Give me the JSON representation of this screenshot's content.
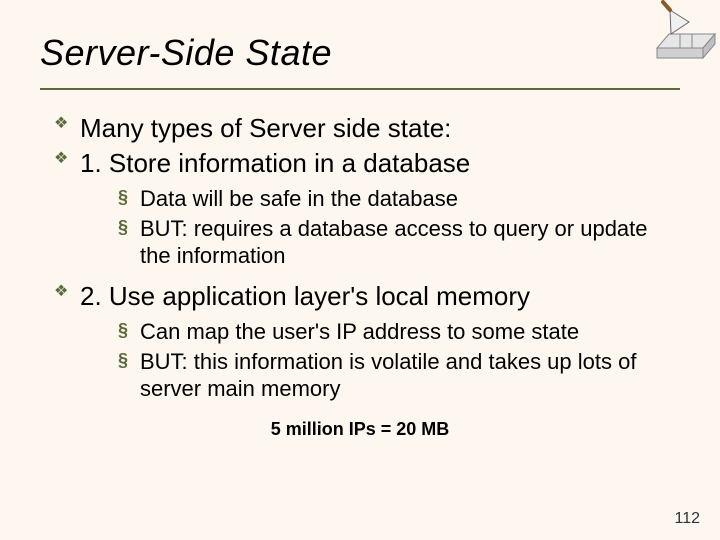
{
  "title": "Server-Side State",
  "bullets": {
    "b0": "Many types of Server side state:",
    "b1": "1. Store information in a database",
    "b1_sub0": "Data will be safe in the database",
    "b1_sub1": "BUT: requires a database access to query or update the information",
    "b2": "2. Use application layer's local memory",
    "b2_sub0": "Can map the user's IP address to some state",
    "b2_sub1": "BUT: this information is volatile and takes up lots of server main memory"
  },
  "footnote": "5 million IPs = 20 MB",
  "page_number": "112"
}
